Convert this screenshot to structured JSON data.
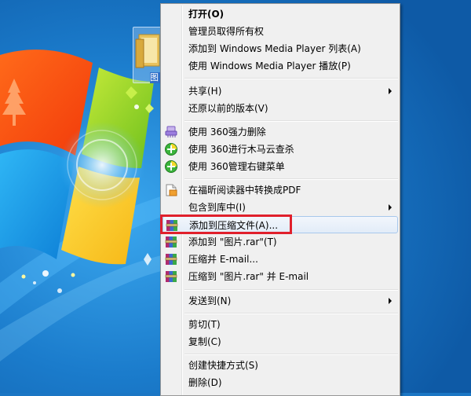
{
  "desktop": {
    "icon_label": "图"
  },
  "menu": {
    "items": [
      {
        "label": "打开(O)"
      },
      {
        "label": "管理员取得所有权"
      },
      {
        "label": "添加到 Windows Media Player 列表(A)"
      },
      {
        "label": "使用 Windows Media Player 播放(P)"
      },
      {
        "label": "共享(H)"
      },
      {
        "label": "还原以前的版本(V)"
      },
      {
        "label": "使用 360强力删除"
      },
      {
        "label": "使用 360进行木马云查杀"
      },
      {
        "label": "使用 360管理右键菜单"
      },
      {
        "label": "在福昕阅读器中转换成PDF"
      },
      {
        "label": "包含到库中(I)"
      },
      {
        "label": "添加到压缩文件(A)..."
      },
      {
        "label": "添加到 \"图片.rar\"(T)"
      },
      {
        "label": "压缩并 E-mail..."
      },
      {
        "label": "压缩到 \"图片.rar\" 并 E-mail"
      },
      {
        "label": "发送到(N)"
      },
      {
        "label": "剪切(T)"
      },
      {
        "label": "复制(C)"
      },
      {
        "label": "创建快捷方式(S)"
      },
      {
        "label": "删除(D)"
      }
    ]
  },
  "colors": {
    "highlight_box": "#e0202c",
    "desktop_blue": "#1b76c4"
  }
}
